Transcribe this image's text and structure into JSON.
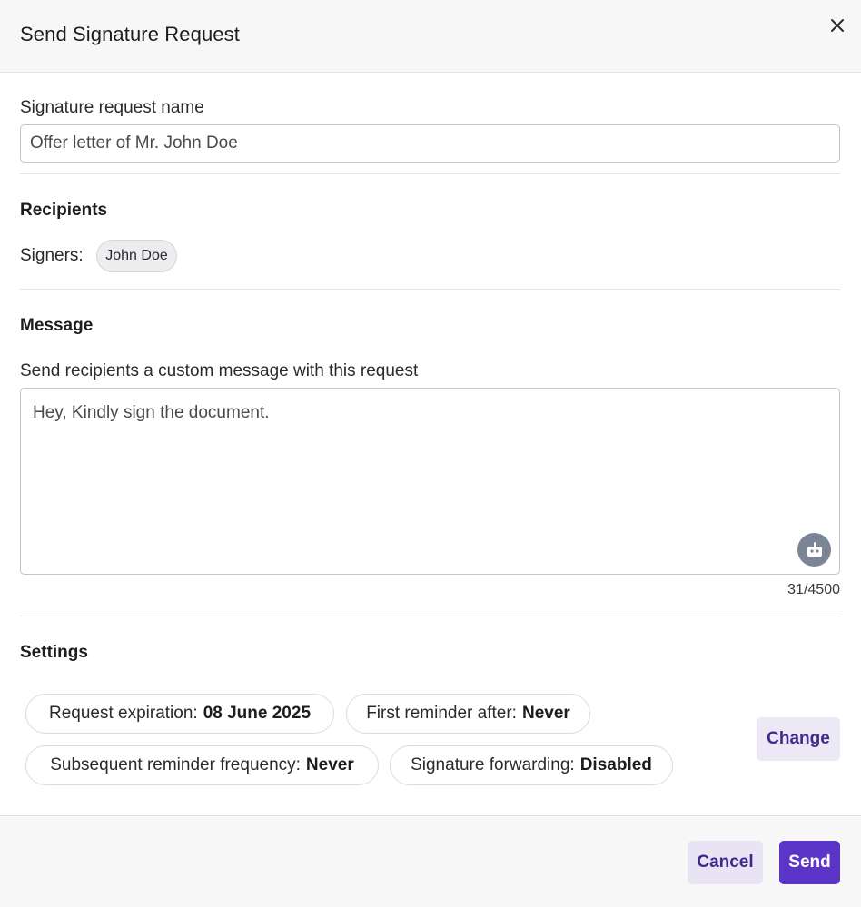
{
  "dialog": {
    "title": "Send Signature Request",
    "close_icon": "close-icon"
  },
  "name_field": {
    "label": "Signature request name",
    "value": "Offer letter of Mr. John Doe"
  },
  "recipients": {
    "title": "Recipients",
    "signers_label": "Signers:",
    "signers": [
      "John Doe"
    ]
  },
  "message": {
    "title": "Message",
    "label": "Send recipients a custom message with this request",
    "value": "Hey, Kindly sign the document.",
    "char_count": "31/4500",
    "assistant_icon": "robot-icon"
  },
  "settings": {
    "title": "Settings",
    "expiration": {
      "label": "Request expiration:",
      "value": "08 June 2025"
    },
    "first_reminder": {
      "label": "First reminder after:",
      "value": "Never"
    },
    "subsequent_reminder": {
      "label": "Subsequent reminder frequency:",
      "value": "Never"
    },
    "forwarding": {
      "label": "Signature forwarding:",
      "value": "Disabled"
    },
    "change_label": "Change"
  },
  "footer": {
    "cancel_label": "Cancel",
    "send_label": "Send"
  },
  "colors": {
    "primary": "#5b35c8",
    "primary_soft": "#ece8f6",
    "primary_text": "#3e2a8f"
  }
}
